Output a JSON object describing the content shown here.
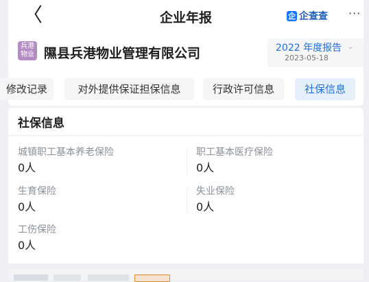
{
  "header": {
    "back_glyph": "〈",
    "title": "企业年报",
    "brand_logo": "企",
    "brand_name": "企查查",
    "more_glyph": "···"
  },
  "company": {
    "logo_text": "兵港物业",
    "name": "隰县兵港物业管理有限公司",
    "report_year": "2022 年度报告",
    "report_date": "2023-05-18",
    "report_chevron": "⌄"
  },
  "tabs": [
    {
      "label": "修改记录",
      "active": false
    },
    {
      "label": "对外提供保证担保信息",
      "active": false
    },
    {
      "label": "行政许可信息",
      "active": false
    },
    {
      "label": "社保信息",
      "active": true
    }
  ],
  "section": {
    "title": "社保信息",
    "fields": [
      {
        "label": "城镇职工基本养老保险",
        "value": "0人"
      },
      {
        "label": "职工基本医疗保险",
        "value": "0人"
      },
      {
        "label": "生育保险",
        "value": "0人"
      },
      {
        "label": "失业保险",
        "value": "0人"
      },
      {
        "label": "工伤保险",
        "value": "0人"
      }
    ]
  },
  "colors": {
    "accent": "#1f6fe0",
    "brand": "#1677ff",
    "company_logo": "#b38cc3"
  },
  "icons": {
    "back": "chevron-left-icon",
    "brand": "qichacha-logo-icon",
    "more": "more-icon",
    "company": "company-logo-icon"
  }
}
